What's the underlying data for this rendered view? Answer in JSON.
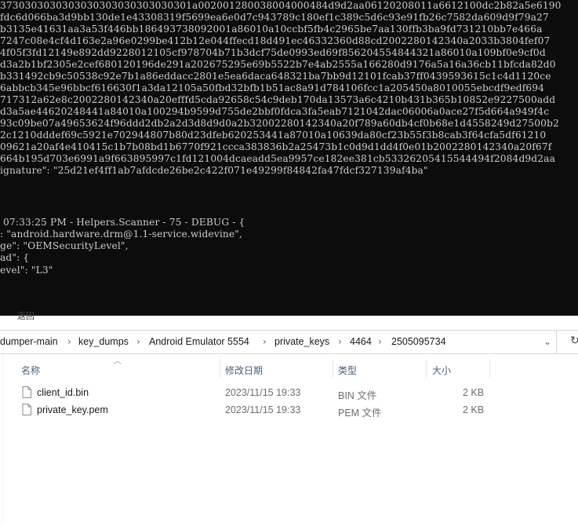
{
  "terminal": {
    "lines": [
      "3730303030303030303030303030301a002001280038004000484d9d2aa06120208011a6612100dc2b82a5e6190",
      "fdc6d066ba3d9bb130de1e43308319f5699ea6e0d7c943789c180ef1c389c5d6c93e91fb26c7582da609d9f79a27",
      "b3135e41631aa3a53f446bb186493738092001a86010a10ccbf5fb4c2965be7aa130ffb3ba9fd731210bb7e466a",
      "7247c08e4cf4d163e2a96e0299be412b12e044ffecd18d491ec46332360d88cd2002280142340a2033b3804fef07",
      "4f05f3fd12149e892dd9228012105cf978704b71b3dcf75de0993ed69f856204554844321a86010a109bf0e9cf0d",
      "d3a2b1bf2305e2cef680120196de291a202675295e69b5522b7e4ab2555a166280d9176a5a16a36cb11bfcda82d0",
      "b331492cb9c50538c92e7b1a86eddacc2801e5ea6daca648321ba7bb9d12101fcab37ff0439593615c1c4d1120ce",
      "6abbcb345e96bbcf616630f1a3da12105a50fbd32bfb1b51ac8a91d784106fcc1a205450a8010055ebcdf9edf694",
      "717312a62e8c2002280142340a20efffd5cda92658c54c9deb170da13573a6c4210b431b365b10852e9227500add",
      "d3a5ae44620248441a84010a100294b9599d755de2bbf0fdca3fa5eab7121042dac06006a0ace27f5d664a949f4c",
      "93c09be07a49653624f96ddd2db2a2d3d8d9d0a2b32002280142340a20f789a60db4cf0b68e1d4558249d27500b2",
      "2c1210dddef69c5921e702944807b80d23dfeb620253441a87010a10639da80cf23b55f3b8cab3f64cfa5df61210",
      "09621a20af4e410415c1b7b08bd1b6770f921ccca383836b2a25473b1c0d9d1dd4f0e01b2002280142340a20f67f",
      "664b195d703e6991a9f663895997c1fd121004dcaeadd5ea9957ce182ee381cb53326205415544494f2084d9d2aa",
      "ignature\": \"25d21ef4ff1ab7afdcde26be2c422f071e49299f84842fa47fdcf327139af4ba\"",
      "",
      "",
      " 07:33:25 PM - Helpers.Scanner - 75 - DEBUG - {",
      ": \"android.hardware.drm@1.1-service.widevine\",",
      "ge\": \"OEMSecurityLevel\",",
      "ad\": {",
      "evel\": \"L3\""
    ]
  },
  "explorer": {
    "menu_fragment": "返回",
    "breadcrumb": [
      "dumper-main",
      "key_dumps",
      "Android Emulator 5554",
      "private_keys",
      "4464",
      "2505095734"
    ],
    "columns": {
      "name": "名称",
      "modified": "修改日期",
      "type": "类型",
      "size": "大小"
    },
    "files": [
      {
        "name": "client_id.bin",
        "modified": "2023/11/15 19:33",
        "type": "BIN 文件",
        "size": "2 KB"
      },
      {
        "name": "private_key.pem",
        "modified": "2023/11/15 19:33",
        "type": "PEM 文件",
        "size": "2 KB"
      }
    ]
  },
  "colors": {
    "terminal_bg": "#0c0c0c",
    "terminal_fg": "#cccccc",
    "header_text": "#4c607a",
    "meta_text": "#6d6d6d"
  },
  "icons": {
    "chevron": "chevron-right-icon",
    "sort": "sort-up-icon",
    "file": "file-icon",
    "refresh": "refresh-icon"
  }
}
